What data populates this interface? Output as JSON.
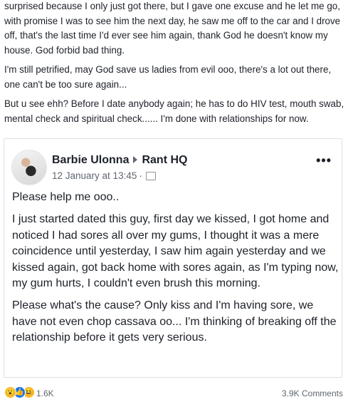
{
  "post": {
    "paragraphs": [
      "surprised because I only just got there, but I gave one excuse and he let me go, with promise I was to see him the next day, he saw me off to the car and I drove off, that's the last time I'd ever see him again, thank God he doesn't know my house. God forbid bad thing.",
      "I'm still petrified, may God save us ladies from evil ooo, there's a lot out there, one can't be too sure again...",
      "But u see ehh? Before I date anybody again; he has to do HIV test, mouth swab, mental check and spiritual check...... I'm done with relationships for now."
    ]
  },
  "shared_post": {
    "author": "Barbie Ulonna",
    "group": "Rant HQ",
    "timestamp": "12 January at 13:45",
    "more_label": "•••",
    "audience_icon": "group-audience-icon",
    "avatar_icon": "profile-photo",
    "paragraphs": [
      "Please help me ooo..",
      "I just started dated this guy, first day we kissed, I got home and noticed I had sores all over my gums, I thought it was a mere coincidence until yesterday, I saw him again yesterday and we kissed again, got back home with sores again, as I'm typing now, my gum hurts, I couldn't even brush this morning.",
      "Please what's the cause? Only kiss and I'm having sore, we have not even chop cassava oo... I'm thinking of breaking off the relationship before it gets very serious."
    ]
  },
  "footer": {
    "reactions": [
      "wow-icon",
      "like-icon",
      "haha-icon"
    ],
    "reaction_count": "1.6K",
    "comment_count": "3.9K Comments"
  },
  "colors": {
    "text": "#1d2129",
    "secondary": "#606770",
    "like_blue": "#1877f2",
    "reaction_yellow": "#f7b928",
    "border": "#dddfe2"
  }
}
